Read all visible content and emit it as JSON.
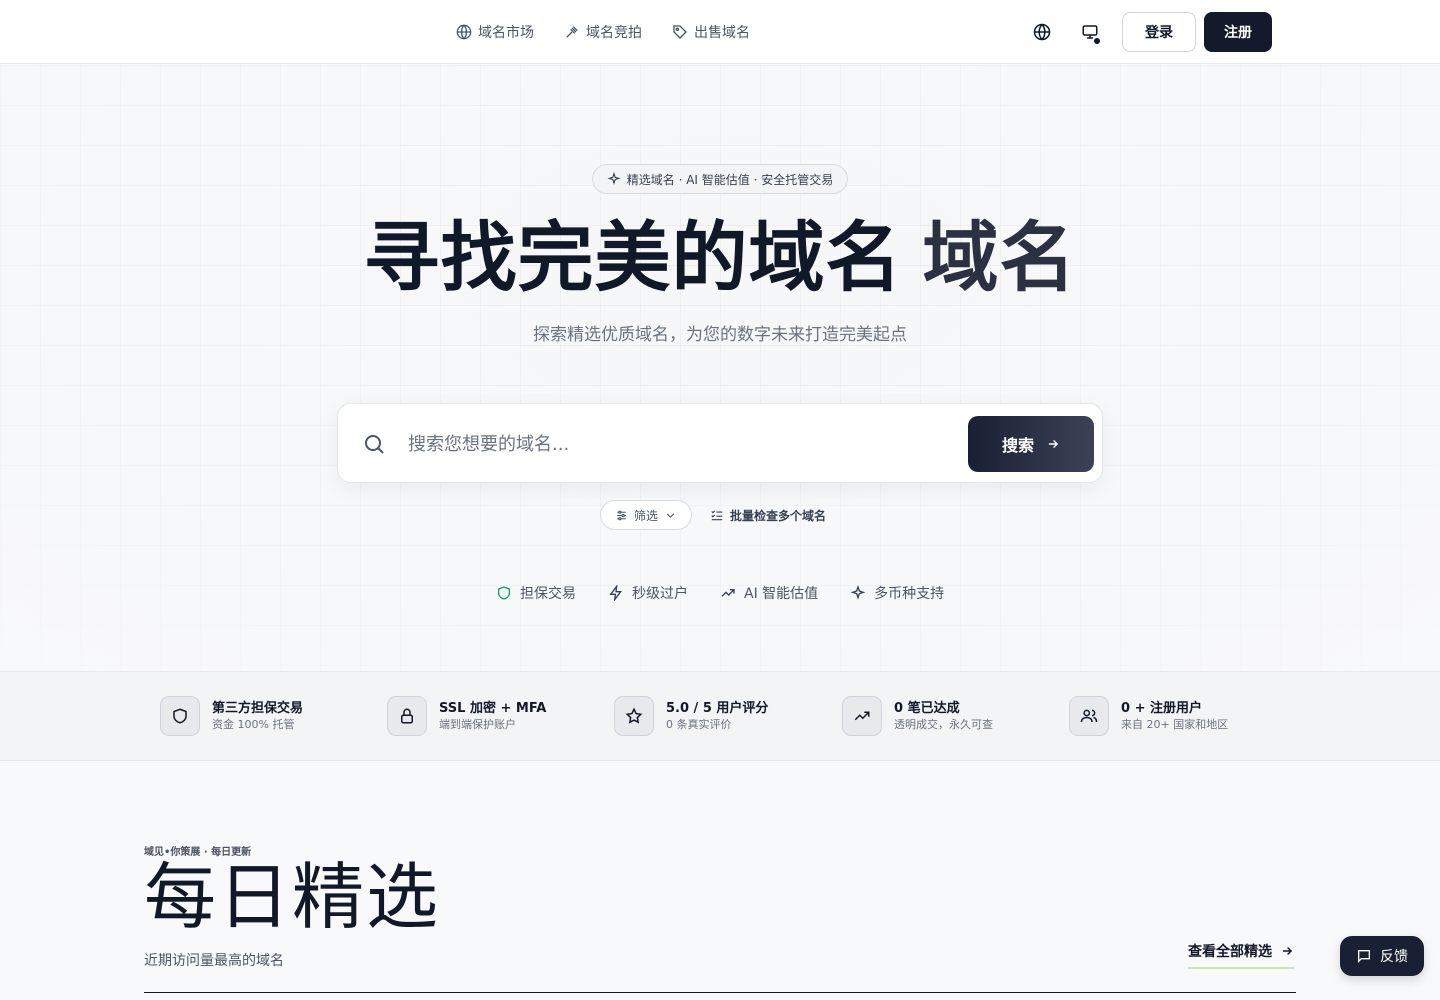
{
  "nav": {
    "links": [
      {
        "label": "域名市场",
        "icon": "globe-icon"
      },
      {
        "label": "域名竞拍",
        "icon": "gavel-icon"
      },
      {
        "label": "出售域名",
        "icon": "tag-icon"
      }
    ],
    "login": "登录",
    "register": "注册"
  },
  "hero": {
    "pill": "精选域名 · AI 智能估值 · 安全托管交易",
    "title_main": "寻找完美的域名",
    "title_accent": "域名",
    "subtitle": "探索精选优质域名，为您的数字未来打造完美起点",
    "search_placeholder": "搜索您想要的域名...",
    "search_button": "搜索",
    "filter_label": "筛选",
    "bulk_label": "批量检查多个域名",
    "features": [
      {
        "label": "担保交易",
        "icon": "shield-icon"
      },
      {
        "label": "秒级过户",
        "icon": "bolt-icon"
      },
      {
        "label": "AI 智能估值",
        "icon": "trend-icon"
      },
      {
        "label": "多币种支持",
        "icon": "sparkle-icon"
      }
    ]
  },
  "stats": [
    {
      "title": "第三方担保交易",
      "desc": "资金 100% 托管",
      "icon": "shield-icon"
    },
    {
      "title": "SSL 加密 + MFA",
      "desc": "端到端保护账户",
      "icon": "lock-icon"
    },
    {
      "title": "5.0 / 5 用户评分",
      "desc": "0 条真实评价",
      "icon": "star-icon"
    },
    {
      "title": "0 笔已达成",
      "desc": "透明成交，永久可查",
      "icon": "trend-icon"
    },
    {
      "title": "0 + 注册用户",
      "desc": "来自 20+ 国家和地区",
      "icon": "users-icon"
    }
  ],
  "daily": {
    "kicker": "域见•你策展 · 每日更新",
    "title": "每日精选",
    "subtitle": "近期访问量最高的域名",
    "view_all": "查看全部精选"
  },
  "feedback": "反馈",
  "colors": {
    "primary": "#141a2b",
    "accent_green": "#16a34a",
    "underline": "#c6e8a8"
  }
}
